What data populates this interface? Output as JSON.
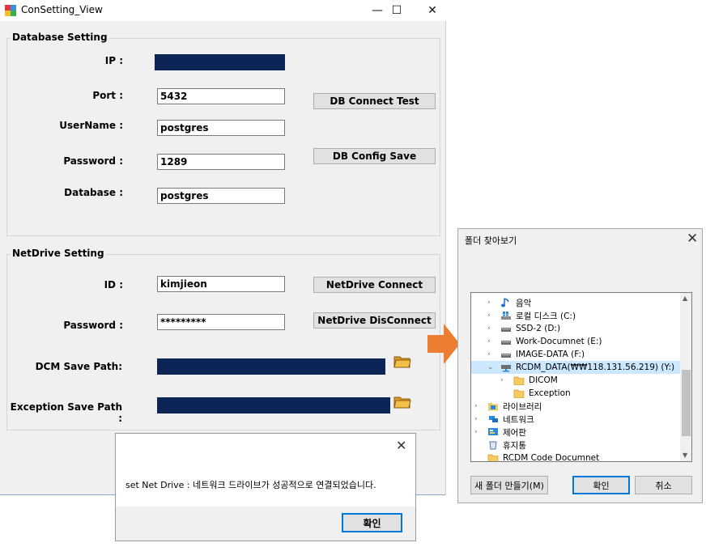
{
  "main_window": {
    "title": "ConSetting_View",
    "minimize_glyph": "—",
    "maximize_glyph": "☐",
    "close_glyph": "✕"
  },
  "database_setting": {
    "group_title": "Database Setting",
    "ip_label": "IP :",
    "ip_value": "",
    "port_label": "Port :",
    "port_value": "5432",
    "username_label": "UserName :",
    "username_value": "postgres",
    "password_label": "Password :",
    "password_value": "1289",
    "database_label": "Database :",
    "database_value": "postgres",
    "test_button": "DB Connect Test",
    "save_button": "DB Config Save"
  },
  "netdrive_setting": {
    "group_title": "NetDrive Setting",
    "id_label": "ID :",
    "id_value": "kimjieon",
    "password_label": "Password :",
    "password_value": "*********",
    "connect_button": "NetDrive Connect",
    "disconnect_button": "NetDrive DisConnect",
    "dcm_path_label": "DCM Save Path:",
    "exception_path_label": "Exception Save Path :"
  },
  "message_box": {
    "text": "set Net Drive : 네트워크 드라이브가 성공적으로 연결되었습니다.",
    "ok_button": "확인",
    "close_glyph": "✕"
  },
  "folder_browser": {
    "title": "폴더 찾아보기",
    "close_glyph": "✕",
    "tree": [
      {
        "label": "음악",
        "icon": "music-icon",
        "indent": 1,
        "chevron": "›"
      },
      {
        "label": "로컬 디스크 (C:)",
        "icon": "windows-drive-icon",
        "indent": 1,
        "chevron": "›"
      },
      {
        "label": "SSD-2 (D:)",
        "icon": "drive-icon",
        "indent": 1,
        "chevron": "›"
      },
      {
        "label": "Work-Documnet (E:)",
        "icon": "drive-icon",
        "indent": 1,
        "chevron": "›"
      },
      {
        "label": "IMAGE-DATA (F:)",
        "icon": "drive-icon",
        "indent": 1,
        "chevron": "›"
      },
      {
        "label": "RCDM_DATA(₩₩118.131.56.219) (Y:)",
        "icon": "network-drive-icon",
        "indent": 1,
        "chevron": "⌄",
        "selected": true
      },
      {
        "label": "DICOM",
        "icon": "folder-icon",
        "indent": 2,
        "chevron": "›"
      },
      {
        "label": "Exception",
        "icon": "folder-icon",
        "indent": 2,
        "chevron": ""
      },
      {
        "label": "라이브러리",
        "icon": "library-icon",
        "indent": 0,
        "chevron": "›"
      },
      {
        "label": "네트워크",
        "icon": "network-icon",
        "indent": 0,
        "chevron": "›"
      },
      {
        "label": "제어판",
        "icon": "control-panel-icon",
        "indent": 0,
        "chevron": "›"
      },
      {
        "label": "휴지통",
        "icon": "recycle-bin-icon",
        "indent": 0,
        "chevron": ""
      },
      {
        "label": "RCDM Code Documnet",
        "icon": "folder-icon",
        "indent": 0,
        "chevron": ""
      }
    ],
    "new_folder_button": "새 폴더 만들기(M)",
    "ok_button": "확인",
    "cancel_button": "취소"
  },
  "colors": {
    "redacted_field": "#0d2457",
    "arrow": "#ed7d31",
    "selection": "#cce8ff",
    "focus_border": "#0078d7"
  }
}
